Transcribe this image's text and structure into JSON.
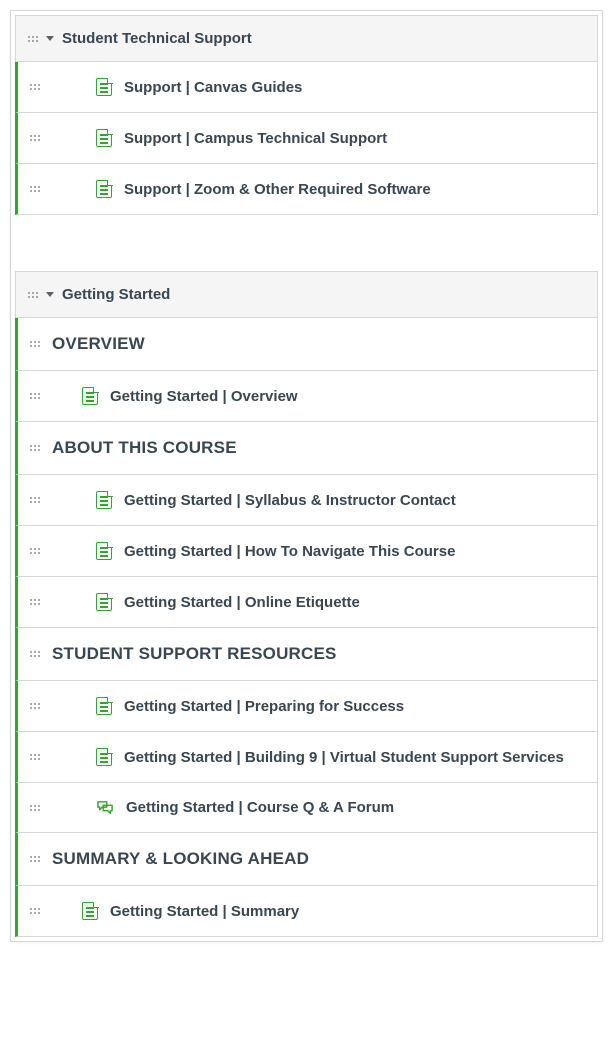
{
  "colors": {
    "accent": "#2fa82f",
    "text": "#3a4650"
  },
  "modules": [
    {
      "title": "Student Technical Support",
      "rows": [
        {
          "kind": "item",
          "indent": 2,
          "icon": "page",
          "label": "Support | Canvas Guides"
        },
        {
          "kind": "item",
          "indent": 2,
          "icon": "page",
          "label": "Support | Campus Technical Support"
        },
        {
          "kind": "item",
          "indent": 2,
          "icon": "page",
          "label": "Support | Zoom & Other Required Software"
        }
      ]
    },
    {
      "title": "Getting Started",
      "rows": [
        {
          "kind": "subheader",
          "label": "OVERVIEW"
        },
        {
          "kind": "item",
          "indent": 1,
          "icon": "page",
          "label": "Getting Started | Overview"
        },
        {
          "kind": "subheader",
          "label": "ABOUT THIS COURSE"
        },
        {
          "kind": "item",
          "indent": 2,
          "icon": "page",
          "label": "Getting Started | Syllabus & Instructor Contact"
        },
        {
          "kind": "item",
          "indent": 2,
          "icon": "page",
          "label": "Getting Started | How To Navigate This Course"
        },
        {
          "kind": "item",
          "indent": 2,
          "icon": "page",
          "label": "Getting Started | Online Etiquette"
        },
        {
          "kind": "subheader",
          "label": "STUDENT SUPPORT RESOURCES"
        },
        {
          "kind": "item",
          "indent": 2,
          "icon": "page",
          "label": "Getting Started | Preparing for Success"
        },
        {
          "kind": "item",
          "indent": 2,
          "icon": "page",
          "label": "Getting Started | Building 9 | Virtual Student Support Services"
        },
        {
          "kind": "item",
          "indent": 2,
          "icon": "discussion",
          "label": "Getting Started | Course Q & A Forum"
        },
        {
          "kind": "subheader",
          "label": "SUMMARY & LOOKING AHEAD"
        },
        {
          "kind": "item",
          "indent": 1,
          "icon": "page",
          "label": "Getting Started | Summary"
        }
      ]
    }
  ]
}
